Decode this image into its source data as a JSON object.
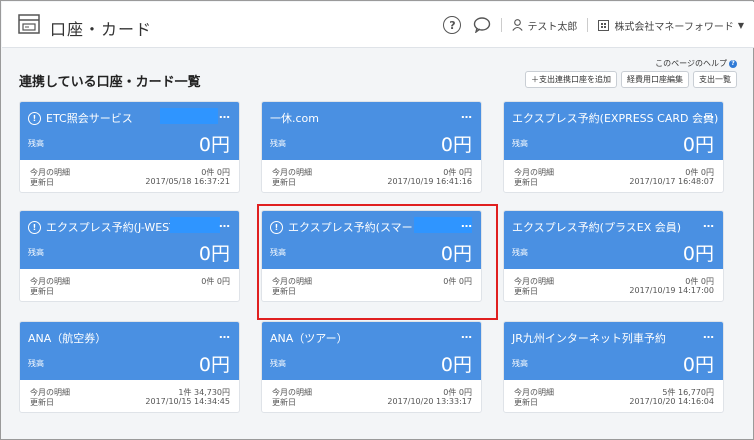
{
  "header": {
    "title": "口座・カード",
    "app_icon": "wallet-card-icon",
    "help_icon": "?",
    "user": "テスト太郎",
    "organization": "株式会社マネーフォワード"
  },
  "page": {
    "heading": "連携している口座・カード一覧",
    "help_link": "このページのヘルプ",
    "buttons": [
      "＋支出連携口座を追加",
      "経費用口座編集",
      "支出一覧"
    ]
  },
  "card_labels": {
    "balance": "残高",
    "monthly": "今月の明細",
    "updated": "更新日",
    "menu": "…",
    "warning": "!"
  },
  "cards": [
    {
      "name": "ETC照会サービス",
      "warning": true,
      "balance": "0円",
      "count": "0件",
      "amount": "0円",
      "updated": "2017/05/18 16:37:21"
    },
    {
      "name": "一休.com",
      "warning": false,
      "balance": "0円",
      "count": "0件",
      "amount": "0円",
      "updated": "2017/10/19 16:41:16"
    },
    {
      "name": "エクスプレス予約(EXPRESS CARD 会員)",
      "warning": false,
      "balance": "0円",
      "count": "0件",
      "amount": "0円",
      "updated": "2017/10/17 16:48:07"
    },
    {
      "name": "エクスプレス予約(J-WEST",
      "warning": true,
      "balance": "0円",
      "count": "0件",
      "amount": "0円",
      "updated": ""
    },
    {
      "name": "エクスプレス予約(スマート",
      "warning": true,
      "balance": "0円",
      "count": "0件",
      "amount": "0円",
      "updated": ""
    },
    {
      "name": "エクスプレス予約(プラスEX 会員)",
      "warning": false,
      "balance": "0円",
      "count": "0件",
      "amount": "0円",
      "updated": "2017/10/19 14:17:00"
    },
    {
      "name": "ANA（航空券）",
      "warning": false,
      "balance": "0円",
      "count": "1件",
      "amount": "34,730円",
      "updated": "2017/10/15 14:34:45"
    },
    {
      "name": "ANA（ツアー）",
      "warning": false,
      "balance": "0円",
      "count": "0件",
      "amount": "0円",
      "updated": "2017/10/20 13:33:17"
    },
    {
      "name": "JR九州インターネット列車予約",
      "warning": false,
      "balance": "0円",
      "count": "5件",
      "amount": "16,770円",
      "updated": "2017/10/20 14:16:04"
    }
  ],
  "colors": {
    "card_header": "#4a90e2",
    "highlight": "#e02020"
  }
}
